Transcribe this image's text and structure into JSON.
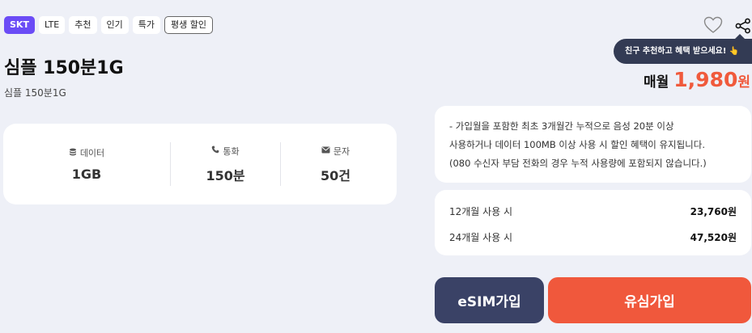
{
  "tags": [
    {
      "label": "SKT",
      "style": "carrier"
    },
    {
      "label": "LTE",
      "style": "plain"
    },
    {
      "label": "추천",
      "style": "plain"
    },
    {
      "label": "인기",
      "style": "plain"
    },
    {
      "label": "특가",
      "style": "plain"
    },
    {
      "label": "평생 할인",
      "style": "outline"
    }
  ],
  "plan": {
    "title": "심플 150분1G",
    "subtitle": "심플 150분1G"
  },
  "specs": [
    {
      "icon": "database-icon",
      "label": "데이터",
      "value": "1GB"
    },
    {
      "icon": "phone-icon",
      "label": "통화",
      "value": "150분"
    },
    {
      "icon": "mail-icon",
      "label": "문자",
      "value": "50건"
    }
  ],
  "actions": {
    "tooltip": "친구 추천하고 혜택 받으세요! 👆"
  },
  "price": {
    "label": "매월",
    "value": "1,980",
    "unit": "원"
  },
  "notice": [
    "- 가입월을 포함한 최초 3개월간 누적으로 음성 20분 이상",
    "사용하거나 데이터 100MB 이상 사용 시 할인 혜택이 유지됩니다.",
    "(080 수신자 부담 전화의 경우 누적 사용량에 포함되지 않습니다.)"
  ],
  "usage": [
    {
      "label": "12개월 사용 시",
      "amount": "23,760원"
    },
    {
      "label": "24개월 사용 시",
      "amount": "47,520원"
    }
  ],
  "buttons": {
    "esim": "eSIM가입",
    "usim": "유심가입"
  },
  "colors": {
    "accent": "#f0583c",
    "carrier": "#6b4cf6",
    "dark": "#3a4266"
  }
}
